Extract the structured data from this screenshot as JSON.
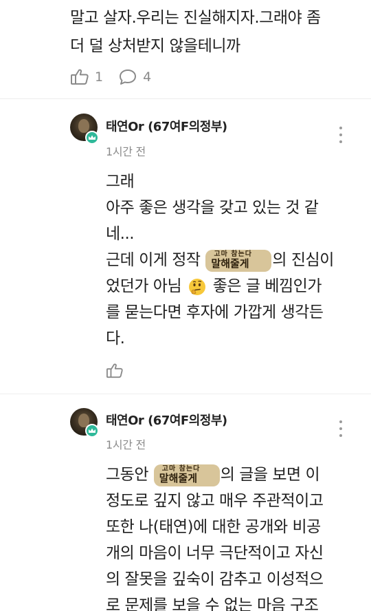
{
  "post": {
    "lines": [
      "말고 살자.우리는 진실해지자.그래야 좀",
      "더 덜 상처받지 않을테니까"
    ],
    "like_count": "1",
    "reply_count": "4"
  },
  "comments": [
    {
      "author": "태연Or (67여F의정부)",
      "time": "1시간 전",
      "line1": "그래",
      "line2": "아주 좋은 생각을 갖고 있는 것 같",
      "line3": "네...",
      "line4_pre": "근데 이게 정작 ",
      "line4_post": "의 진심이",
      "line5_pre": "었던가 아님 ",
      "line5_post": " 좋은 글 베낌인가",
      "line6": "를 묻는다면 후자에 가깝게 생각든",
      "line7": "다.",
      "sticker_top": "고마 참는다",
      "sticker_main": "말해줄게",
      "emoji_icon": "thinking-face-icon"
    },
    {
      "author": "태연Or (67여F의정부)",
      "time": "1시간 전",
      "line1_pre": "그동안 ",
      "line1_post": "의 글을 보면 이",
      "line2": "정도로 깊지 않고 매우 주관적이고",
      "line3": "또한 나(태연)에 대한 공개와 비공",
      "line4": "개의 마음이 너무 극단적이고 자신",
      "line5": "의 잘못을 깊숙이 감추고 이성적으",
      "line6": "로 문제를 보을 수 없는 마음 구조",
      "sticker_top": "고마 참는다",
      "sticker_main": "말해줄게"
    }
  ],
  "colors": {
    "badge": "#2fb99a",
    "meta": "#8b8b8b",
    "text": "#1f1f1f",
    "icon": "#8a8a8a"
  }
}
